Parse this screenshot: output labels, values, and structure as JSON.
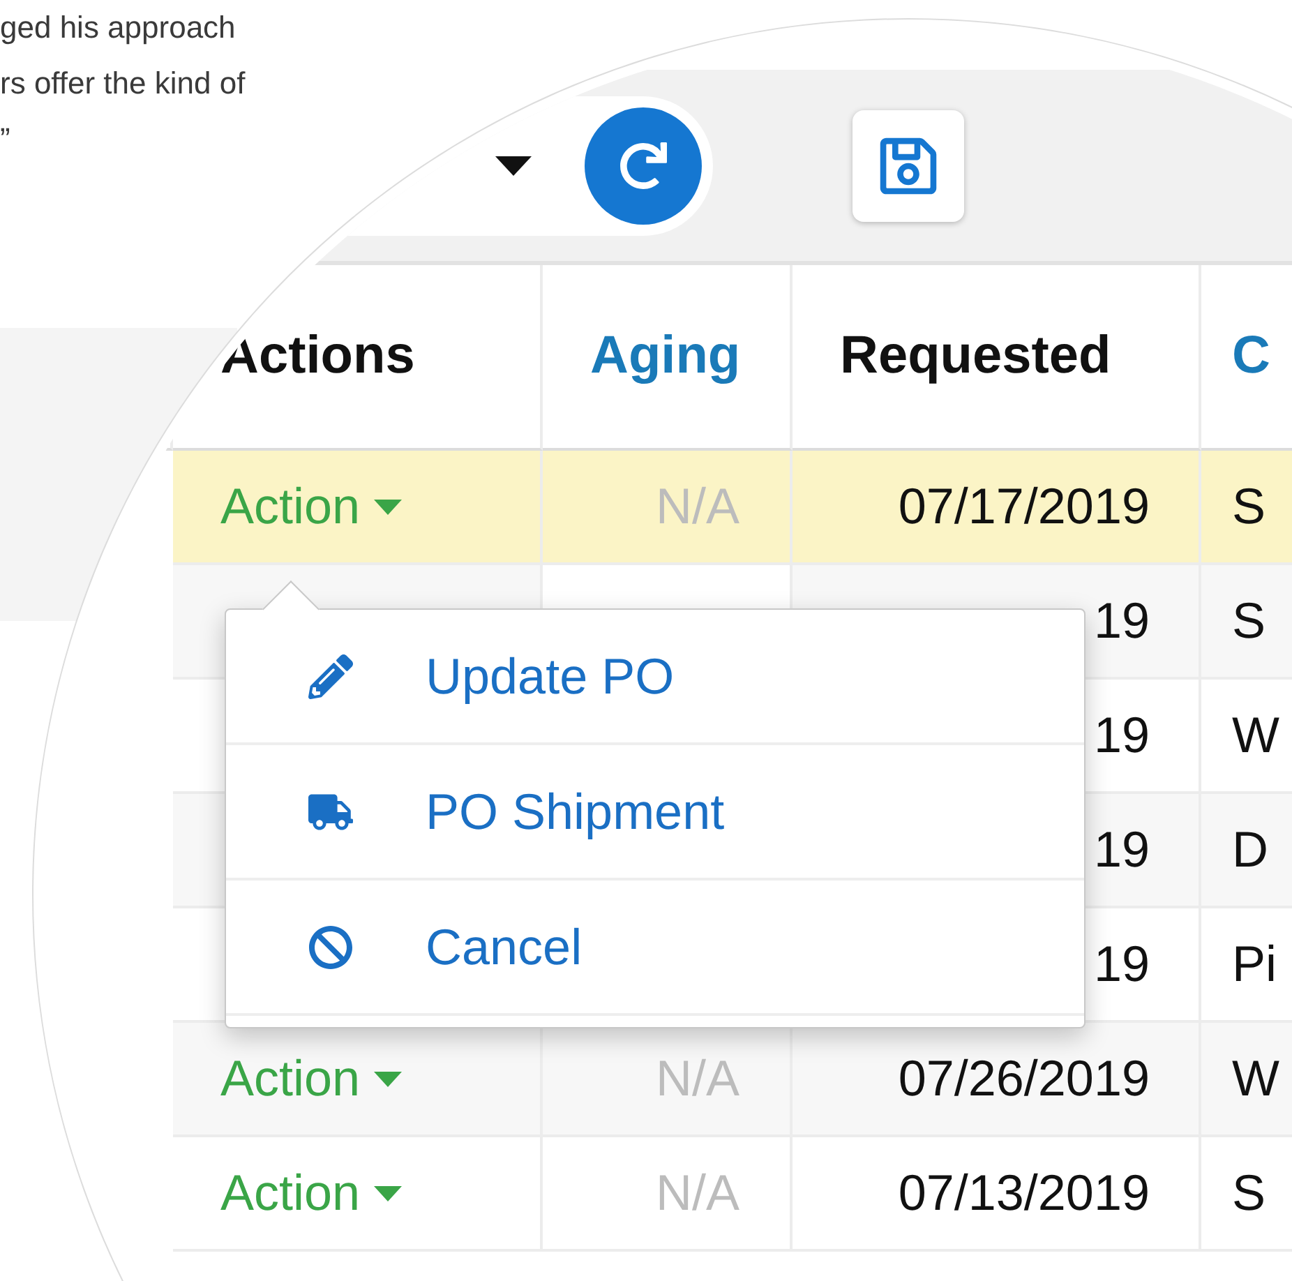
{
  "article": {
    "lines": [
      "ged his approach",
      "rs offer the kind of",
      "”"
    ]
  },
  "columns": [
    {
      "label": "Actions",
      "sortable": false
    },
    {
      "label": "Aging",
      "sortable": true
    },
    {
      "label": "Requested",
      "sortable": false
    },
    {
      "label": "C",
      "sortable": true
    }
  ],
  "rows": [
    {
      "selected": true,
      "action": "Action",
      "aging": "N/A",
      "requested": "07/17/2019",
      "customer": "S"
    },
    {
      "selected": false,
      "requested": "19",
      "customer": "S"
    },
    {
      "selected": false,
      "requested": "19",
      "customer": "W"
    },
    {
      "selected": false,
      "requested": "19",
      "customer": "D"
    },
    {
      "selected": false,
      "requested": "19",
      "customer": "Pi"
    },
    {
      "selected": false,
      "action": "Action",
      "aging": "N/A",
      "requested": "07/26/2019",
      "customer": "W"
    },
    {
      "selected": false,
      "action": "Action",
      "aging": "N/A",
      "requested": "07/13/2019",
      "customer": "S"
    }
  ],
  "menu": {
    "items": [
      {
        "kind": "edit",
        "label": "Update PO"
      },
      {
        "kind": "shipment",
        "label": "PO Shipment"
      },
      {
        "kind": "cancel",
        "label": "Cancel"
      }
    ]
  }
}
